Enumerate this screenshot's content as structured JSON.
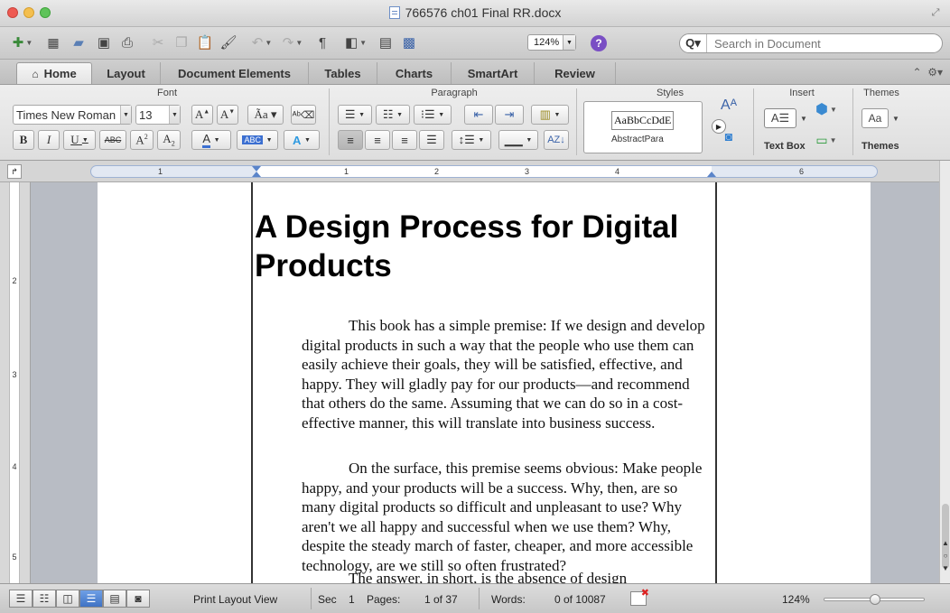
{
  "window": {
    "title": "766576 ch01 Final RR.docx"
  },
  "toolbar": {
    "zoom": "124%",
    "search_placeholder": "Search in Document"
  },
  "tabs": [
    "Home",
    "Layout",
    "Document Elements",
    "Tables",
    "Charts",
    "SmartArt",
    "Review"
  ],
  "ribbon": {
    "groups": {
      "font": "Font",
      "paragraph": "Paragraph",
      "styles": "Styles",
      "insert": "Insert",
      "themes": "Themes"
    },
    "font_name": "Times New Roman",
    "font_size": "13",
    "style_sample": "AaBbCcDdE",
    "style_name": "AbstractPara",
    "text_box_label": "Text Box",
    "themes_label": "Themes",
    "themes_sample": "Aa"
  },
  "ruler": {
    "marks": [
      "1",
      "1",
      "2",
      "3",
      "4",
      "6"
    ]
  },
  "vruler": {
    "marks": [
      "2",
      "3",
      "4",
      "5"
    ]
  },
  "document": {
    "heading": "A Design Process for Digital Products",
    "paragraphs": [
      "This book has a simple premise: If we design and develop digital products in such a way that the people who use them can easily achieve their goals, they will be satisfied, effective, and happy. They will gladly pay for our products—and recommend that others do the same. Assuming that we can do so in a cost-effective manner, this will translate into business success.",
      "On the surface, this premise seems obvious: Make people happy, and your products will be a success. Why, then, are so many digital products so difficult and unpleasant to use? Why aren't we all happy and successful when we use them? Why, despite the steady march of faster, cheaper, and more accessible technology, are we still so often frustrated?",
      "The answer, in short, is the absence of design"
    ]
  },
  "status": {
    "view": "Print Layout View",
    "sec_label": "Sec",
    "sec_value": "1",
    "pages_label": "Pages:",
    "pages_value": "1 of 37",
    "words_label": "Words:",
    "words_value": "0 of 10087",
    "zoom": "124%"
  },
  "colors": {
    "accent": "#3f72c4",
    "help": "#7a4fc4",
    "close": "#ee5a52",
    "minimize": "#f4bf4f",
    "maximize": "#5fc35a"
  }
}
